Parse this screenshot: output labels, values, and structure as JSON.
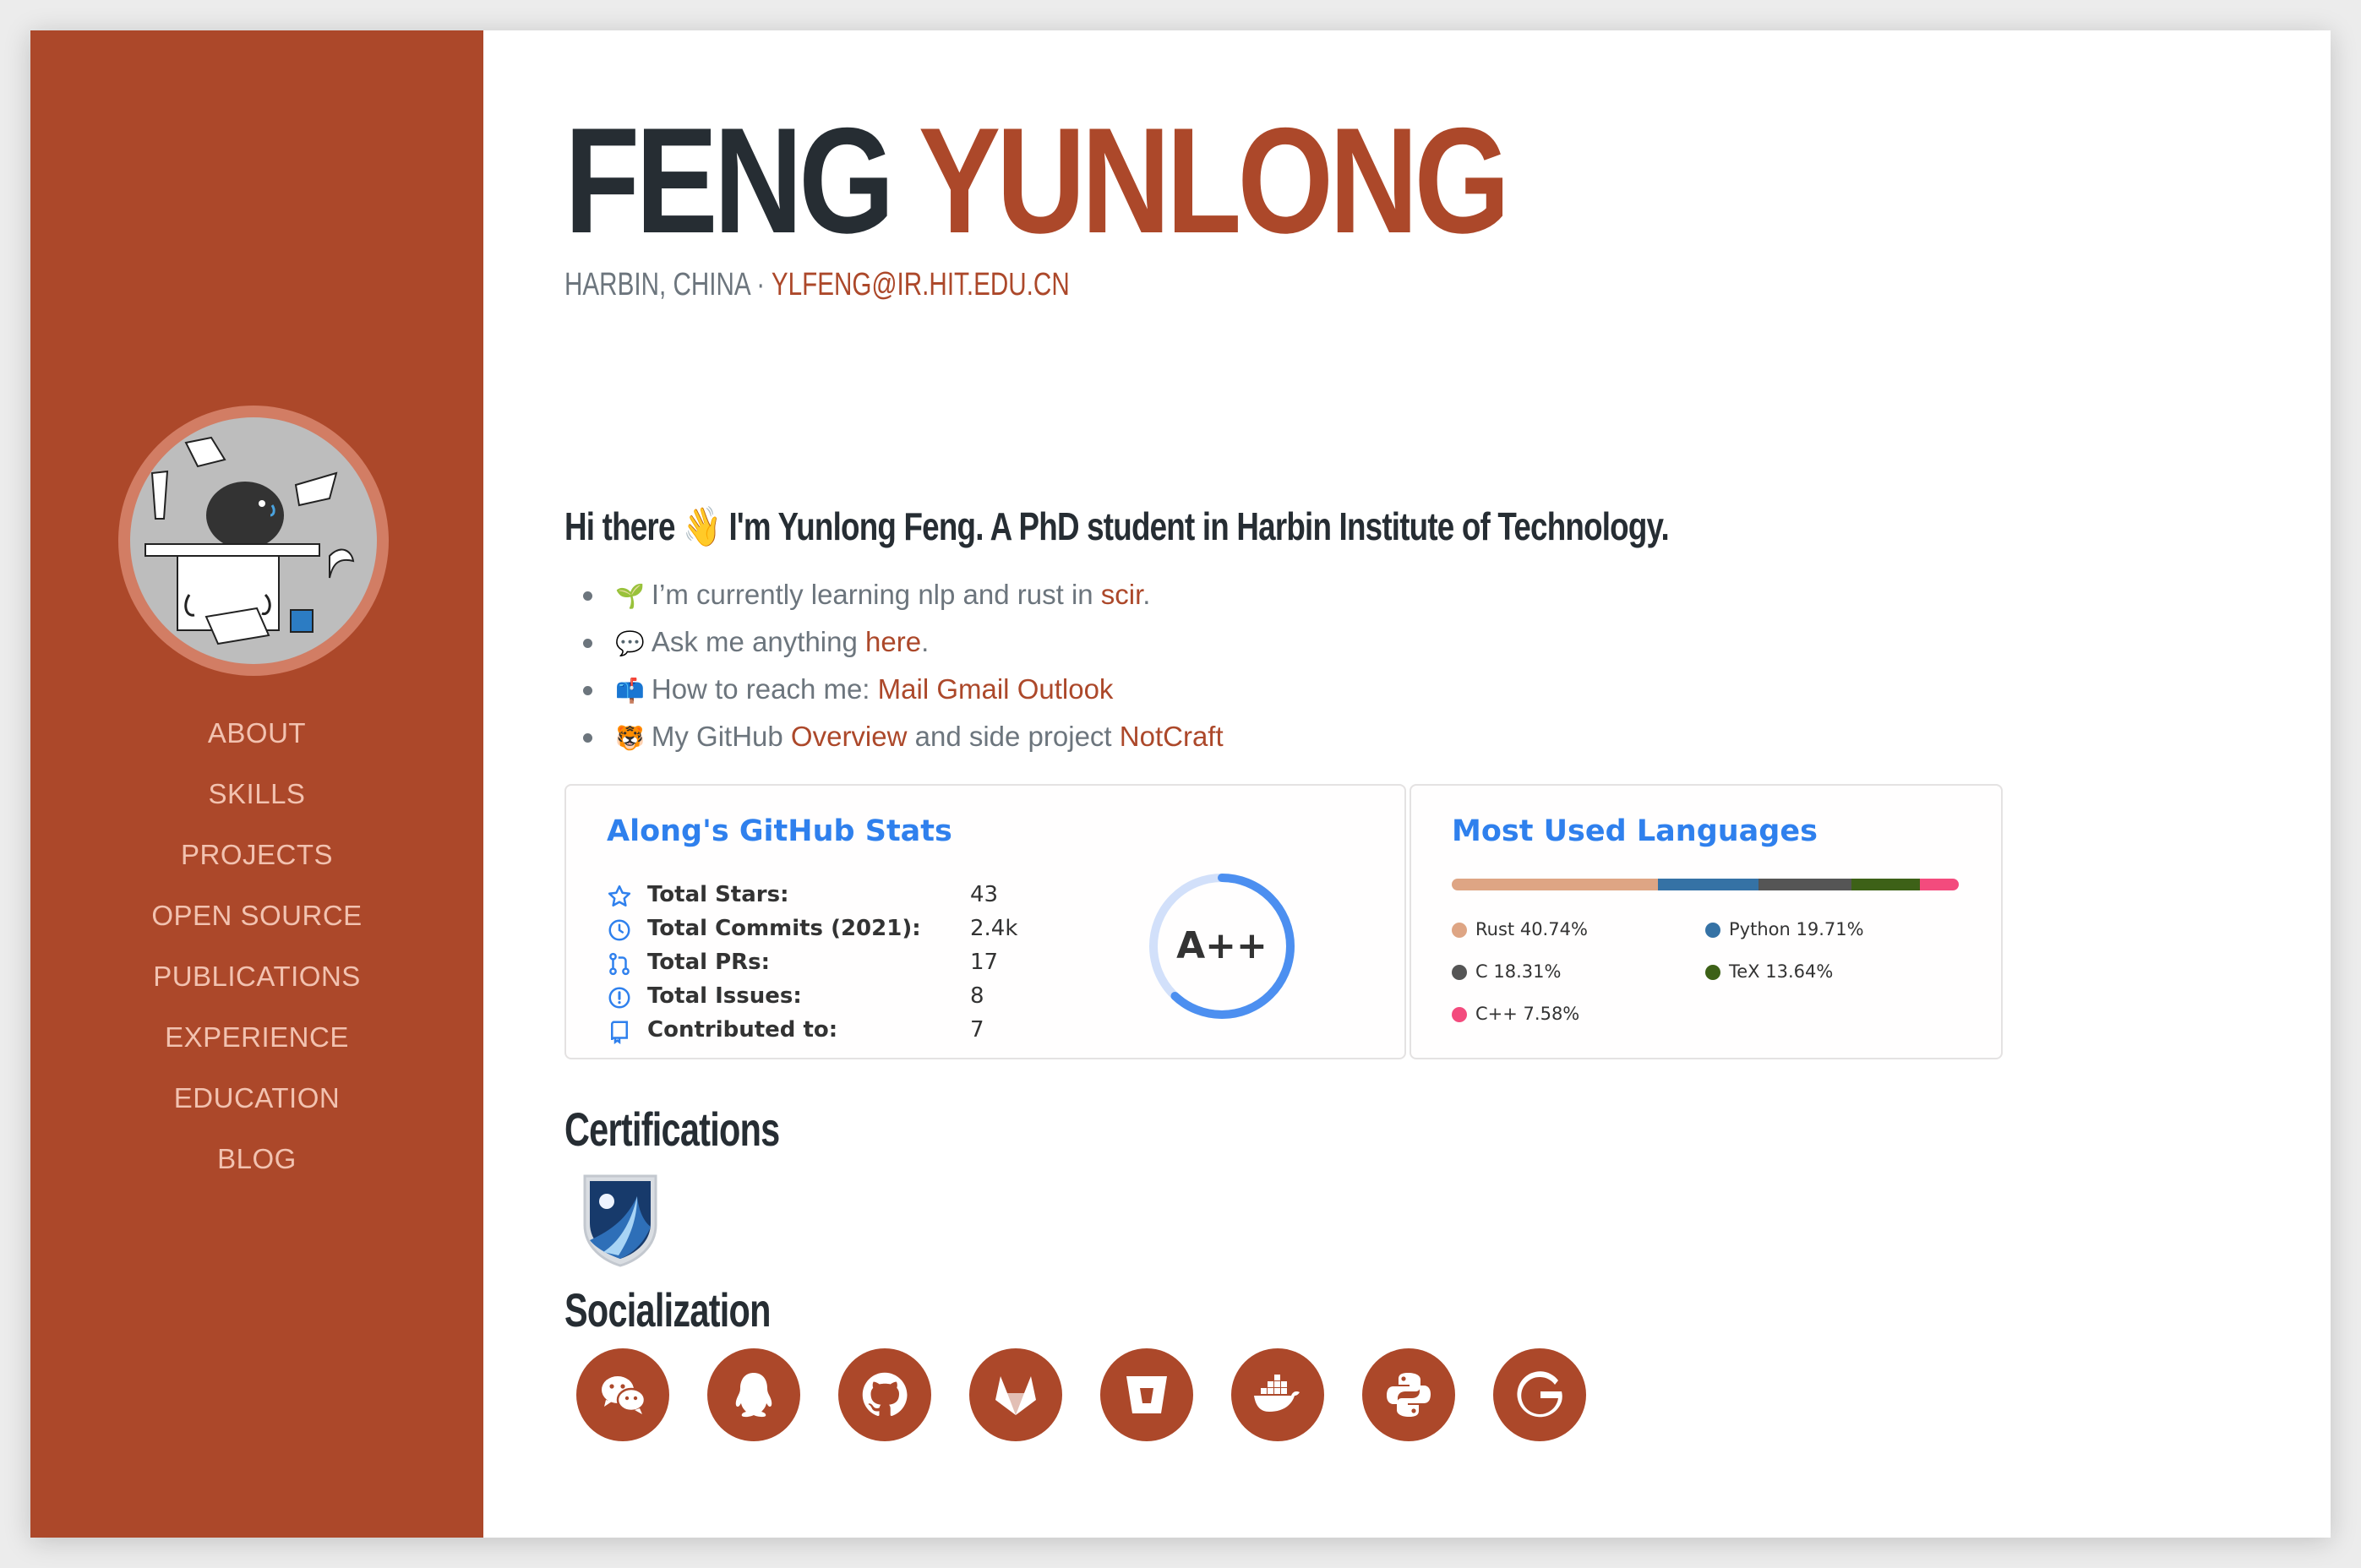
{
  "sidebar": {
    "nav": [
      {
        "label": "ABOUT"
      },
      {
        "label": "SKILLS"
      },
      {
        "label": "PROJECTS"
      },
      {
        "label": "OPEN SOURCE"
      },
      {
        "label": "PUBLICATIONS"
      },
      {
        "label": "EXPERIENCE"
      },
      {
        "label": "EDUCATION"
      },
      {
        "label": "BLOG"
      }
    ]
  },
  "header": {
    "first_name": "FENG",
    "last_name": "YUNLONG",
    "location": "HARBIN, CHINA",
    "separator": " · ",
    "email": "YLFENG@IR.HIT.EDU.CN"
  },
  "about": {
    "intro_a": "Hi there",
    "intro_emoji": "👋",
    "intro_b": "I'm Yunlong Feng. A PhD student in Harbin Institute of Technology.",
    "bullets": {
      "b1": {
        "emoji": "🌱",
        "text": "I’m currently learning nlp and rust in ",
        "link": "scir",
        "tail": "."
      },
      "b2": {
        "emoji": "💬",
        "text": "Ask me anything ",
        "link": "here",
        "tail": "."
      },
      "b3": {
        "emoji": "📫",
        "text": "How to reach me: ",
        "link1": "Mail",
        "link2": "Gmail",
        "link3": "Outlook"
      },
      "b4": {
        "emoji": "🐯",
        "text": "My GitHub ",
        "link1": "Overview",
        "middle": " and side project ",
        "link2": "NotCraft"
      }
    }
  },
  "github_stats": {
    "title": "Along's GitHub Stats",
    "rows": [
      {
        "label": "Total Stars:",
        "value": "43",
        "icon": "star-icon"
      },
      {
        "label": "Total Commits (2021):",
        "value": "2.4k",
        "icon": "history-icon"
      },
      {
        "label": "Total PRs:",
        "value": "17",
        "icon": "pull-request-icon"
      },
      {
        "label": "Total Issues:",
        "value": "8",
        "icon": "issue-icon"
      },
      {
        "label": "Contributed to:",
        "value": "7",
        "icon": "repo-icon"
      }
    ],
    "grade": "A++",
    "grade_ring_fraction": 0.62,
    "colors": {
      "title": "#2f80ed",
      "ring": "#4c8ff0",
      "ring_track": "#d2e0fa"
    }
  },
  "languages": {
    "title": "Most Used Languages",
    "items": [
      {
        "name": "Rust",
        "pct": "40.74%",
        "value": 40.74,
        "color": "#dea584"
      },
      {
        "name": "Python",
        "pct": "19.71%",
        "value": 19.71,
        "color": "#3572A5"
      },
      {
        "name": "C",
        "pct": "18.31%",
        "value": 18.31,
        "color": "#555555"
      },
      {
        "name": "TeX",
        "pct": "13.64%",
        "value": 13.64,
        "color": "#3D6117"
      },
      {
        "name": "C++",
        "pct": "7.58%",
        "value": 7.58,
        "color": "#f34b7d"
      }
    ]
  },
  "certifications": {
    "heading": "Certifications",
    "badge": "certification-badge"
  },
  "socialization": {
    "heading": "Socialization",
    "icons": [
      "wechat-icon",
      "qq-icon",
      "github-icon",
      "gitlab-icon",
      "bitbucket-icon",
      "docker-icon",
      "python-icon",
      "google-icon"
    ]
  },
  "theme": {
    "accent": "#ac482a",
    "dark": "#262d33",
    "muted": "#6c757d"
  }
}
